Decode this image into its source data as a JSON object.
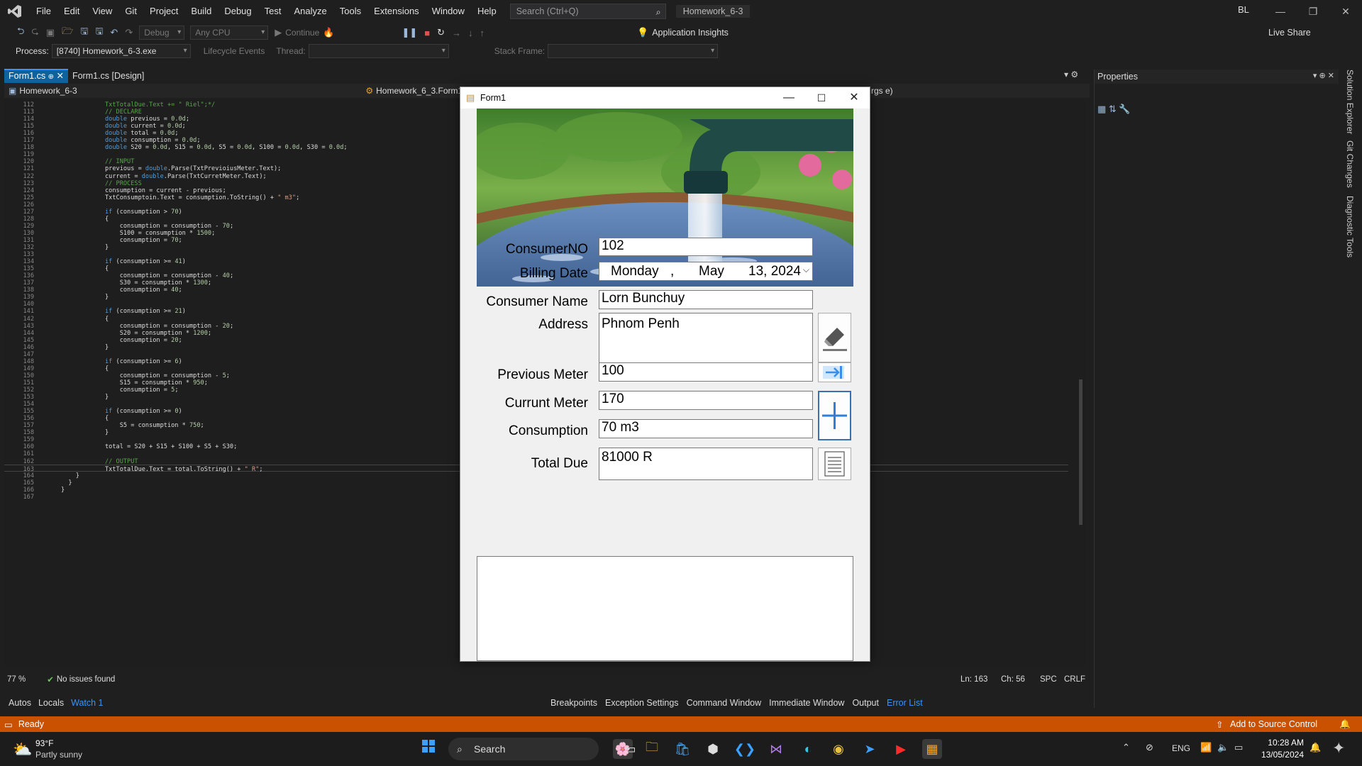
{
  "menu": [
    "File",
    "Edit",
    "View",
    "Git",
    "Project",
    "Build",
    "Debug",
    "Test",
    "Analyze",
    "Tools",
    "Extensions",
    "Window",
    "Help"
  ],
  "search": {
    "placeholder": "Search (Ctrl+Q)"
  },
  "project_badge": "Homework_6-3",
  "user_initials": "BL",
  "toolbar": {
    "config": "Debug",
    "platform": "Any CPU",
    "continue": "Continue",
    "app_insights": "Application Insights",
    "live_share": "Live Share"
  },
  "procbar": {
    "process_label": "Process:",
    "process_value": "[8740] Homework_6-3.exe",
    "lifecycle": "Lifecycle Events",
    "thread": "Thread:",
    "stack": "Stack Frame:"
  },
  "tabs": [
    {
      "label": "Form1.cs"
    },
    {
      "label": "Form1.cs [Design]"
    }
  ],
  "navbar": {
    "project": "Homework_6-3",
    "class": "Homework_6_3.Form1",
    "member": "rgs e)"
  },
  "editor": {
    "lines": [
      {
        "n": "112",
        "t": "TxtTotalDue.Text += \" Riel\";*/"
      },
      {
        "n": "113",
        "t": "// DECLARE"
      },
      {
        "n": "114",
        "t": "double previous = 0.0d;"
      },
      {
        "n": "115",
        "t": "double current = 0.0d;"
      },
      {
        "n": "116",
        "t": "double total = 0.0d;"
      },
      {
        "n": "117",
        "t": "double consumption = 0.0d;"
      },
      {
        "n": "118",
        "t": "double S20 = 0.0d, S15 = 0.0d, S5 = 0.0d, S100 = 0.0d, S30 = 0.0d;"
      },
      {
        "n": "119",
        "t": ""
      },
      {
        "n": "120",
        "t": "// INPUT"
      },
      {
        "n": "121",
        "t": "previous = double.Parse(TxtPrevioiusMeter.Text);"
      },
      {
        "n": "122",
        "t": "current = double.Parse(TxtCurretMeter.Text);"
      },
      {
        "n": "123",
        "t": "// PROCESS"
      },
      {
        "n": "124",
        "t": "consumption = current - previous;"
      },
      {
        "n": "125",
        "t": "TxtConsumptoin.Text = consumption.ToString() + \" m3\";"
      },
      {
        "n": "126",
        "t": ""
      },
      {
        "n": "127",
        "t": "if (consumption > 70)"
      },
      {
        "n": "128",
        "t": "{"
      },
      {
        "n": "129",
        "t": "    consumption = consumption - 70;"
      },
      {
        "n": "130",
        "t": "    S100 = consumption * 1500;"
      },
      {
        "n": "131",
        "t": "    consumption = 70;"
      },
      {
        "n": "132",
        "t": "}"
      },
      {
        "n": "133",
        "t": ""
      },
      {
        "n": "134",
        "t": "if (consumption >= 41)"
      },
      {
        "n": "135",
        "t": "{"
      },
      {
        "n": "136",
        "t": "    consumption = consumption - 40;"
      },
      {
        "n": "137",
        "t": "    S30 = consumption * 1300;"
      },
      {
        "n": "138",
        "t": "    consumption = 40;"
      },
      {
        "n": "139",
        "t": "}"
      },
      {
        "n": "140",
        "t": ""
      },
      {
        "n": "141",
        "t": "if (consumption >= 21)"
      },
      {
        "n": "142",
        "t": "{"
      },
      {
        "n": "143",
        "t": "    consumption = consumption - 20;"
      },
      {
        "n": "144",
        "t": "    S20 = consumption * 1200;"
      },
      {
        "n": "145",
        "t": "    consumption = 20;"
      },
      {
        "n": "146",
        "t": "}"
      },
      {
        "n": "147",
        "t": ""
      },
      {
        "n": "148",
        "t": "if (consumption >= 6)"
      },
      {
        "n": "149",
        "t": "{"
      },
      {
        "n": "150",
        "t": "    consumption = consumption - 5;"
      },
      {
        "n": "151",
        "t": "    S15 = consumption * 950;"
      },
      {
        "n": "152",
        "t": "    consumption = 5;"
      },
      {
        "n": "153",
        "t": "}"
      },
      {
        "n": "154",
        "t": ""
      },
      {
        "n": "155",
        "t": "if (consumption >= 0)"
      },
      {
        "n": "156",
        "t": "{"
      },
      {
        "n": "157",
        "t": "    S5 = consumption * 750;"
      },
      {
        "n": "158",
        "t": "}"
      },
      {
        "n": "159",
        "t": ""
      },
      {
        "n": "160",
        "t": "total = S20 + S15 + S100 + S5 + S30;"
      },
      {
        "n": "161",
        "t": ""
      },
      {
        "n": "162",
        "t": "// OUTPUT"
      },
      {
        "n": "163",
        "t": "TxtTotalDue.Text = total.ToString() + \" R\";"
      },
      {
        "n": "164",
        "t": "    }"
      },
      {
        "n": "165",
        "t": "  }"
      },
      {
        "n": "166",
        "t": "}"
      },
      {
        "n": "167",
        "t": ""
      }
    ]
  },
  "editor_status": {
    "zoom": "77 %",
    "issues": "No issues found",
    "ln": "Ln: 163",
    "ch": "Ch: 56",
    "spc": "SPC",
    "crlf": "CRLF"
  },
  "bottom_tabs_left": [
    "Autos",
    "Locals",
    "Watch 1"
  ],
  "bottom_tabs_right": [
    "Breakpoints",
    "Exception Settings",
    "Command Window",
    "Immediate Window",
    "Output",
    "Error List"
  ],
  "statusbar": {
    "ready": "Ready",
    "source_control": "Add to Source Control"
  },
  "properties": {
    "title": "Properties"
  },
  "side_tabs": [
    "Solution Explorer",
    "Git Changes",
    "Diagnostic Tools"
  ],
  "form": {
    "title": "Form1",
    "consumer_no_label": "ConsumerNO",
    "consumer_no": "102",
    "billing_date_label": "Billing Date",
    "billing_day": "Monday",
    "billing_sep": ",",
    "billing_month": "May",
    "billing_rest": "13, 2024",
    "consumer_name_label": "Consumer Name",
    "consumer_name": "Lorn Bunchuy",
    "address_label": "Address",
    "address": "Phnom Penh",
    "previous_meter_label": "Previous Meter",
    "previous_meter": "100",
    "current_meter_label": "Currunt Meter",
    "current_meter": "170",
    "consumption_label": "Consumption",
    "consumption": "70 m3",
    "total_due_label": "Total Due",
    "total_due": "81000 R"
  },
  "weather": {
    "temp": "93°F",
    "desc": "Partly sunny"
  },
  "taskbar": {
    "search": "Search",
    "lang": "ENG",
    "time": "10:28 AM",
    "date": "13/05/2024"
  }
}
